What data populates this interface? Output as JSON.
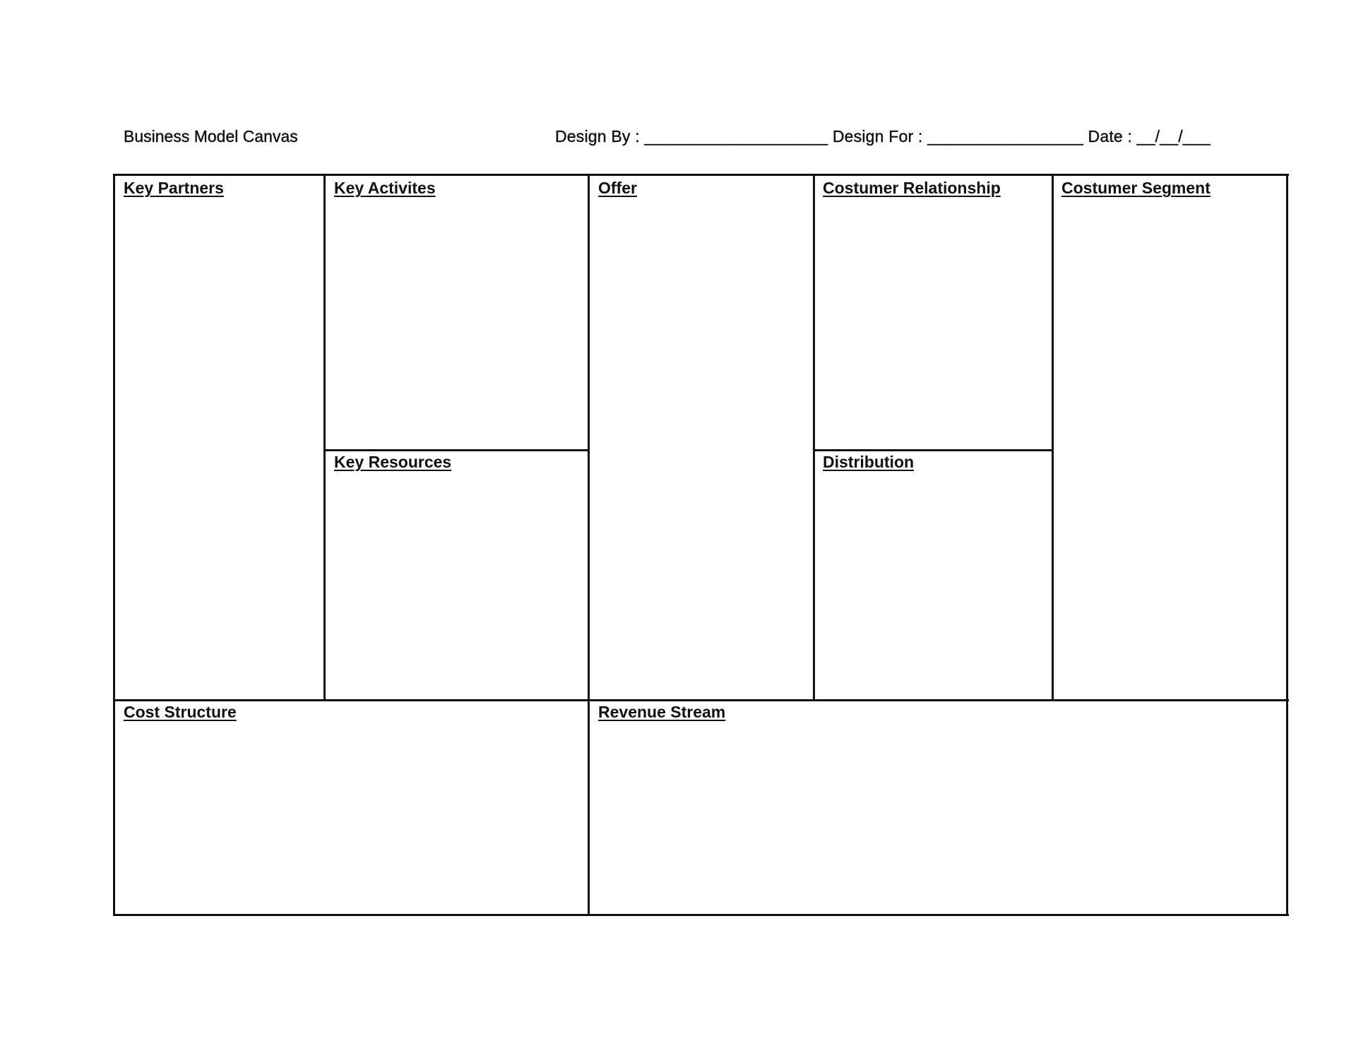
{
  "header": {
    "title": "Business Model Canvas",
    "design_by_label": "Design By : ____________________",
    "design_for_label": " Design For : _________________",
    "date_label": " Date : __/__/___"
  },
  "canvas": {
    "key_partners": "Key Partners",
    "key_activities": "Key Activites",
    "key_resources": "Key Resources",
    "offer": "Offer",
    "customer_relationship": "Costumer Relationship",
    "distribution": "Distribution",
    "customer_segment": "Costumer Segment",
    "cost_structure": "Cost Structure",
    "revenue_stream": "Revenue Stream"
  }
}
